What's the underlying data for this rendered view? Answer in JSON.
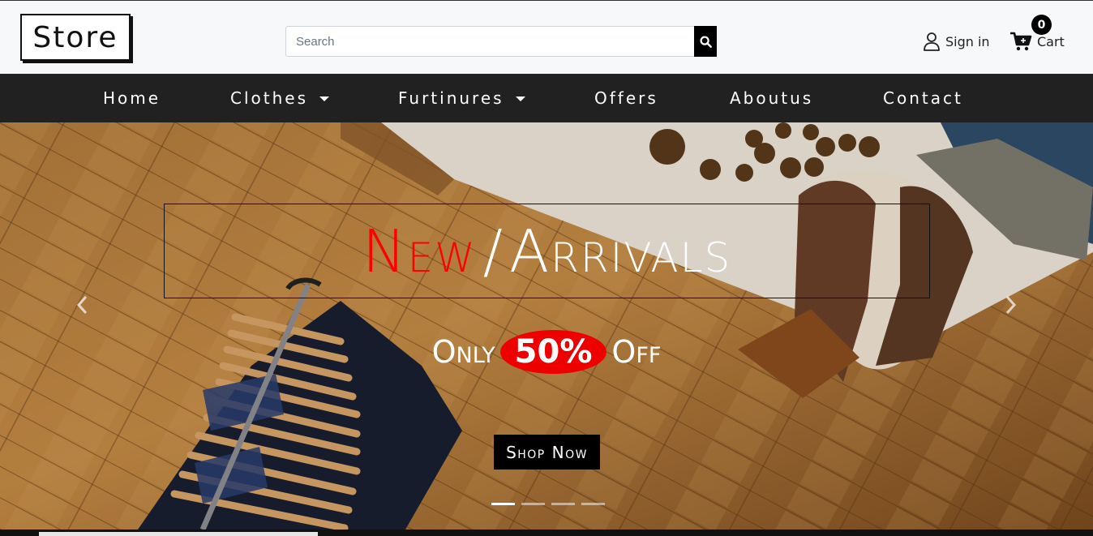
{
  "header": {
    "logo": "Store",
    "search_placeholder": "Search",
    "search_icon": "search-icon",
    "signin_label": "Sign in",
    "signin_icon": "user-icon",
    "cart_label": "Cart",
    "cart_icon": "cart-icon",
    "cart_count": "0"
  },
  "nav": {
    "items": [
      {
        "label": "Home"
      },
      {
        "label": "Clothes",
        "dropdown": true
      },
      {
        "label": "Furtinures",
        "dropdown": true
      },
      {
        "label": "Offers"
      },
      {
        "label": "Aboutus"
      },
      {
        "label": "Contact"
      }
    ]
  },
  "hero": {
    "title_new": "New",
    "title_slash": "/",
    "title_arrivals": "Arrivals",
    "offer_prefix": "Only",
    "offer_percent": "50%",
    "offer_suffix": "Off",
    "cta_label": "Shop Now",
    "slide_count": 4,
    "active_slide": 1
  },
  "colors": {
    "accent_red": "#ff0000",
    "nav_bg": "#212121",
    "button_bg": "#000000"
  }
}
